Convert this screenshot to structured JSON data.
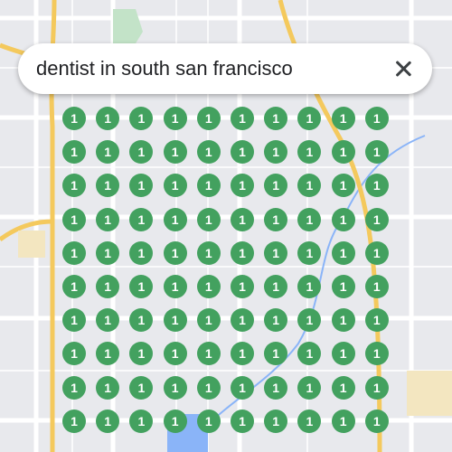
{
  "search": {
    "query": "dentist in south san francisco",
    "close_icon": "close-icon"
  },
  "colors": {
    "pin": "#43a15f",
    "map_bg": "#e8e9ed",
    "highway": "#f4c95d",
    "park": "#c3e3c8",
    "water": "#8ab4f8"
  },
  "grid": {
    "rows": [
      [
        "1",
        "1",
        "1",
        "1",
        "1",
        "1",
        "1",
        "1",
        "1",
        "1"
      ],
      [
        "1",
        "1",
        "1",
        "1",
        "1",
        "1",
        "1",
        "1",
        "1",
        "1"
      ],
      [
        "1",
        "1",
        "1",
        "1",
        "1",
        "1",
        "1",
        "1",
        "1",
        "1"
      ],
      [
        "1",
        "1",
        "1",
        "1",
        "1",
        "1",
        "1",
        "1",
        "1",
        "1"
      ],
      [
        "1",
        "1",
        "1",
        "1",
        "1",
        "1",
        "1",
        "1",
        "1",
        "1"
      ],
      [
        "1",
        "1",
        "1",
        "1",
        "1",
        "1",
        "1",
        "1",
        "1",
        "1"
      ],
      [
        "1",
        "1",
        "1",
        "1",
        "1",
        "1",
        "1",
        "1",
        "1",
        "1"
      ],
      [
        "1",
        "1",
        "1",
        "1",
        "1",
        "1",
        "1",
        "1",
        "1",
        "1"
      ],
      [
        "1",
        "1",
        "1",
        "1",
        "1",
        "1",
        "1",
        "1",
        "1",
        "1"
      ],
      [
        "1",
        "1",
        "1",
        "1",
        "1",
        "1",
        "1",
        "1",
        "1",
        "1"
      ]
    ]
  }
}
